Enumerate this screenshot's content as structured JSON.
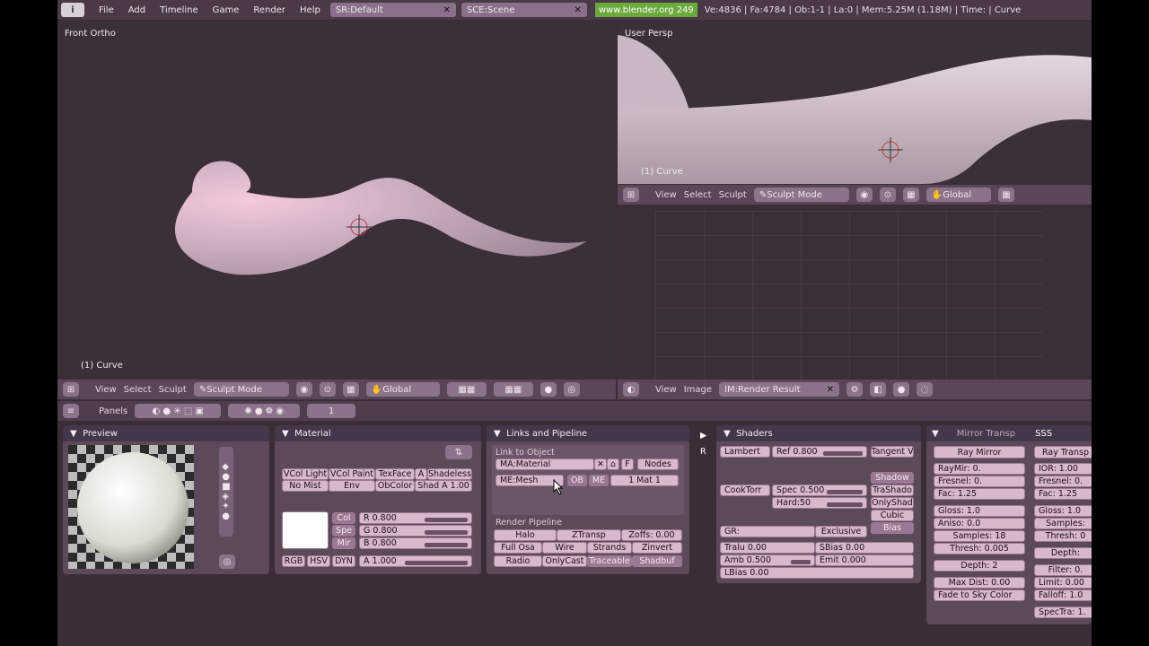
{
  "topbar": {
    "menus": [
      "File",
      "Add",
      "Timeline",
      "Game",
      "Render",
      "Help"
    ],
    "screen": "SR:Default",
    "scene": "SCE:Scene",
    "url": "www.blender.org 249",
    "stats": "Ve:4836 | Fa:4784 | Ob:1-1 | La:0   | Mem:5.25M (1.18M)   | Time:  | Curve"
  },
  "front": {
    "title": "Front Ortho",
    "object": "(1) Curve"
  },
  "persp": {
    "title": "User Persp",
    "object": "(1) Curve"
  },
  "vheader": {
    "view": "View",
    "select": "Select",
    "sculpt": "Sculpt",
    "mode": "Sculpt Mode",
    "global": "Global"
  },
  "imgheader": {
    "view": "View",
    "image": "Image",
    "result": "IM:Render Result"
  },
  "buttonsbar": {
    "panels": "Panels",
    "frame": "1"
  },
  "preview": {
    "title": "Preview"
  },
  "material": {
    "title": "Material",
    "row1": [
      "VCol Light",
      "VCol Paint",
      "TexFace",
      "A",
      "Shadeless"
    ],
    "row2": [
      "No Mist",
      "Env",
      "ObColor",
      "Shad A 1.00"
    ],
    "col_labels": [
      "Col",
      "Spe",
      "Mir"
    ],
    "r": "R 0.800",
    "g": "G 0.800",
    "b": "B 0.800",
    "a": "A 1.000",
    "modes": [
      "RGB",
      "HSV",
      "DYN"
    ],
    "color": "#ffffff"
  },
  "links": {
    "title": "Links and Pipeline",
    "link_to": "Link to Object",
    "ma": "MA:Material",
    "f": "F",
    "nodes": "Nodes",
    "me": "ME:Mesh",
    "ob": "OB",
    "me_btn": "ME",
    "mat": "1 Mat 1",
    "pipeline": "Render Pipeline",
    "p1": [
      "Halo",
      "ZTransp",
      "Zoffs: 0.00"
    ],
    "p2": [
      "Full Osa",
      "Wire",
      "Strands",
      "Zinvert"
    ],
    "p3": [
      "Radio",
      "OnlyCast",
      "Traceable",
      "Shadbuf"
    ]
  },
  "shaders": {
    "title": "Shaders",
    "lambert": "Lambert",
    "ref": "Ref  0.800",
    "tangent": "Tangent V",
    "cooktorr": "CookTorr",
    "spec": "Spec 0.500",
    "hard": "Hard:50",
    "shadow_opts": [
      "Shadow",
      "TraShado",
      "OnlyShad",
      "Cubic",
      "Bias"
    ],
    "gr": "GR:",
    "exclusive": "Exclusive",
    "tralu": "Tralu 0.00",
    "sbias": "SBias 0.00",
    "amb": "Amb 0.500",
    "emit": "Emit 0.000",
    "lbias": "LBias 0.00"
  },
  "mirror": {
    "tab1": "Mirror Transp",
    "tab2": "SSS",
    "raymirror": "Ray Mirror",
    "raytransp": "Ray Transp",
    "left": [
      "RayMir: 0.",
      "Fresnel: 0.",
      "Fac: 1.25",
      "Gloss: 1.0",
      "Aniso: 0.0",
      "Samples: 18",
      "Thresh: 0.005",
      "Depth: 2",
      "Max Dist: 0.00",
      "Fade to Sky Color"
    ],
    "right": [
      "IOR: 1.00",
      "Fresnel: 0.",
      "Fac: 1.25",
      "Gloss: 1.0",
      "Samples:",
      "Thresh: 0",
      "Depth:",
      "Filter: 0.",
      "Limit: 0.00",
      "Falloff: 1.0",
      "SpecTra: 1."
    ]
  }
}
